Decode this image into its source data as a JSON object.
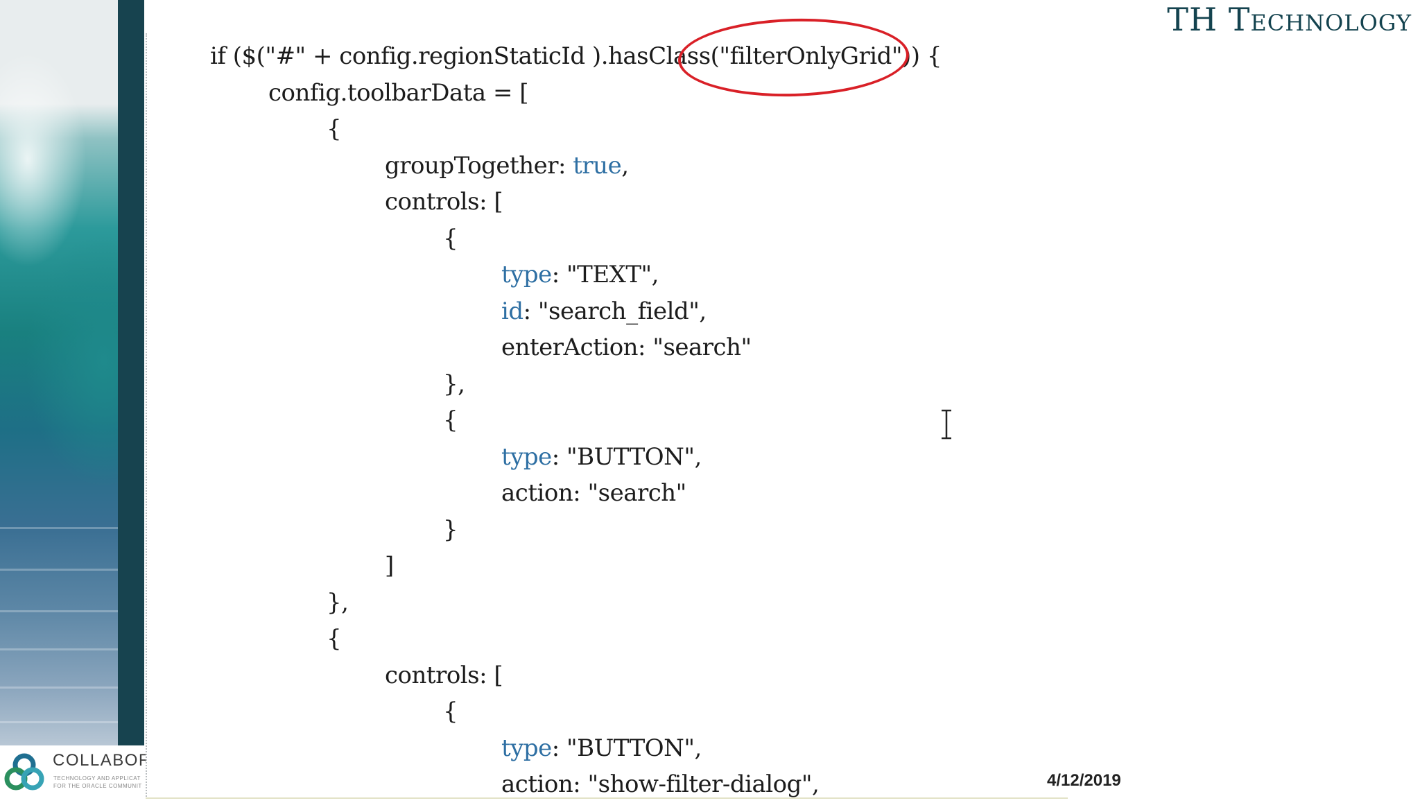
{
  "brand": {
    "title": "TH Technology"
  },
  "code_lines": [
    {
      "indent": 0,
      "parts": [
        {
          "t": "if ($(\"#\" + config.regionStaticId ).hasClass(\"filterOnlyGrid\")) {",
          "k": false
        }
      ]
    },
    {
      "indent": 1,
      "parts": [
        {
          "t": "config.toolbarData = [",
          "k": false
        }
      ]
    },
    {
      "indent": 2,
      "parts": [
        {
          "t": "{",
          "k": false
        }
      ]
    },
    {
      "indent": 3,
      "parts": [
        {
          "t": "groupTogether: ",
          "k": false
        },
        {
          "t": "true",
          "k": true
        },
        {
          "t": ",",
          "k": false
        }
      ]
    },
    {
      "indent": 3,
      "parts": [
        {
          "t": "controls: [",
          "k": false
        }
      ]
    },
    {
      "indent": 4,
      "parts": [
        {
          "t": "{",
          "k": false
        }
      ]
    },
    {
      "indent": 5,
      "parts": [
        {
          "t": "type",
          "k": true
        },
        {
          "t": ": \"TEXT\",",
          "k": false
        }
      ]
    },
    {
      "indent": 5,
      "parts": [
        {
          "t": "id",
          "k": true
        },
        {
          "t": ": \"search_field\",",
          "k": false
        }
      ]
    },
    {
      "indent": 5,
      "parts": [
        {
          "t": "enterAction: \"search\"",
          "k": false
        }
      ]
    },
    {
      "indent": 4,
      "parts": [
        {
          "t": "},",
          "k": false
        }
      ]
    },
    {
      "indent": 4,
      "parts": [
        {
          "t": "{",
          "k": false
        }
      ]
    },
    {
      "indent": 5,
      "parts": [
        {
          "t": "type",
          "k": true
        },
        {
          "t": ": \"BUTTON\",",
          "k": false
        }
      ]
    },
    {
      "indent": 5,
      "parts": [
        {
          "t": "action: \"search\"",
          "k": false
        }
      ]
    },
    {
      "indent": 4,
      "parts": [
        {
          "t": "}",
          "k": false
        }
      ]
    },
    {
      "indent": 3,
      "parts": [
        {
          "t": "]",
          "k": false
        }
      ]
    },
    {
      "indent": 2,
      "parts": [
        {
          "t": "},",
          "k": false
        }
      ]
    },
    {
      "indent": 2,
      "parts": [
        {
          "t": "{",
          "k": false
        }
      ]
    },
    {
      "indent": 3,
      "parts": [
        {
          "t": "controls: [",
          "k": false
        }
      ]
    },
    {
      "indent": 4,
      "parts": [
        {
          "t": "{",
          "k": false
        }
      ]
    },
    {
      "indent": 5,
      "parts": [
        {
          "t": "type",
          "k": true
        },
        {
          "t": ": \"BUTTON\",",
          "k": false
        }
      ]
    },
    {
      "indent": 5,
      "parts": [
        {
          "t": "action: \"show-filter-dialog\",",
          "k": false
        }
      ]
    }
  ],
  "logo": {
    "name": "COLLABOR",
    "tagline_1": "TECHNOLOGY AND APPLICAT",
    "tagline_2": "FOR THE ORACLE COMMUNIT"
  },
  "footer": {
    "date": "4/12/2019"
  },
  "colors": {
    "brand": "#14434f",
    "keyword": "#2e6fa3",
    "highlight": "#d92027",
    "dark_bar": "#17434f"
  },
  "icons": {
    "cursor": "text-cursor-icon",
    "highlight": "highlight-circle"
  }
}
